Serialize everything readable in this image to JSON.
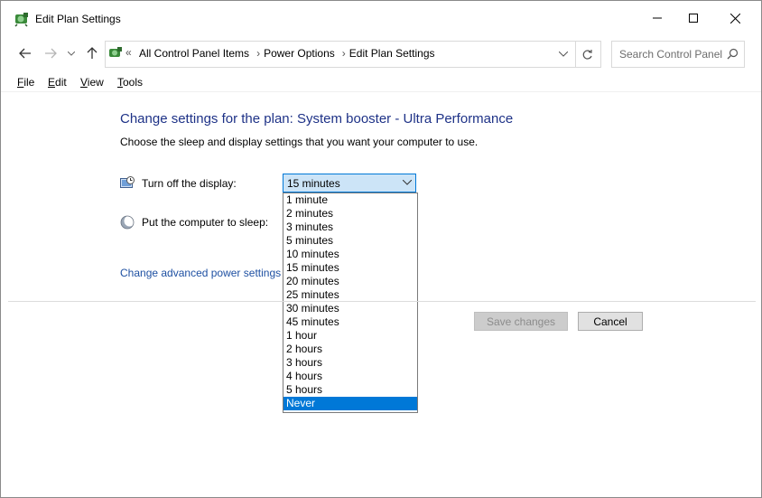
{
  "window": {
    "title": "Edit Plan Settings",
    "controls": {
      "minimize": "minimize",
      "maximize": "maximize",
      "close": "close"
    }
  },
  "address_bar": {
    "overflow": "«",
    "crumbs": [
      "All Control Panel Items",
      "Power Options",
      "Edit Plan Settings"
    ],
    "search_placeholder": "Search Control Panel"
  },
  "menu": {
    "items": [
      {
        "label": "File",
        "accel": "F",
        "rest": "ile"
      },
      {
        "label": "Edit",
        "accel": "E",
        "rest": "dit"
      },
      {
        "label": "View",
        "accel": "V",
        "rest": "iew"
      },
      {
        "label": "Tools",
        "accel": "T",
        "rest": "ools"
      }
    ]
  },
  "main": {
    "heading": "Change settings for the plan: System booster - Ultra Performance",
    "subheading": "Choose the sleep and display settings that you want your computer to use.",
    "display_label": "Turn off the display:",
    "display_value": "15 minutes",
    "sleep_label": "Put the computer to sleep:",
    "advanced_link": "Change advanced power settings",
    "save_label": "Save changes",
    "cancel_label": "Cancel"
  },
  "dropdown": {
    "options": [
      "1 minute",
      "2 minutes",
      "3 minutes",
      "5 minutes",
      "10 minutes",
      "15 minutes",
      "20 minutes",
      "25 minutes",
      "30 minutes",
      "45 minutes",
      "1 hour",
      "2 hours",
      "3 hours",
      "4 hours",
      "5 hours",
      "Never"
    ],
    "highlighted": "Never"
  },
  "colors": {
    "heading": "#1e3287",
    "link": "#1e50a2",
    "highlight": "#0078d7"
  }
}
